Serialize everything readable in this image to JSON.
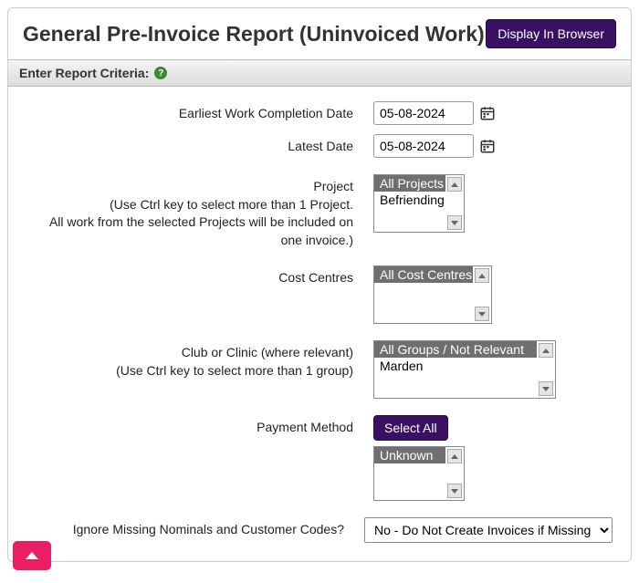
{
  "header": {
    "title": "General Pre-Invoice Report (Uninvoiced Work)",
    "display_button": "Display In Browser"
  },
  "criteria_bar": {
    "label": "Enter Report Criteria:"
  },
  "fields": {
    "earliest": {
      "label": "Earliest Work Completion Date",
      "value": "05-08-2024"
    },
    "latest": {
      "label": "Latest Date",
      "value": "05-08-2024"
    },
    "project": {
      "label": "Project\n(Use Ctrl key to select more than 1 Project.\nAll work from the selected Projects will be included on one invoice.)",
      "options": [
        "All Projects",
        "Befriending"
      ],
      "selected": "All Projects"
    },
    "cost_centres": {
      "label": "Cost Centres",
      "options": [
        "All Cost Centres"
      ],
      "selected": "All Cost Centres"
    },
    "club": {
      "label": "Club or Clinic (where relevant)\n(Use Ctrl key to select more than 1 group)",
      "options": [
        "All Groups / Not Relevant",
        "Marden"
      ],
      "selected": "All Groups / Not Relevant"
    },
    "payment_method": {
      "label": "Payment Method",
      "select_all": "Select All",
      "options": [
        "Unknown"
      ],
      "selected": "Unknown"
    },
    "ignore_missing": {
      "label": "Ignore Missing Nominals and Customer Codes?",
      "value": "No - Do Not Create Invoices if Missing"
    }
  }
}
